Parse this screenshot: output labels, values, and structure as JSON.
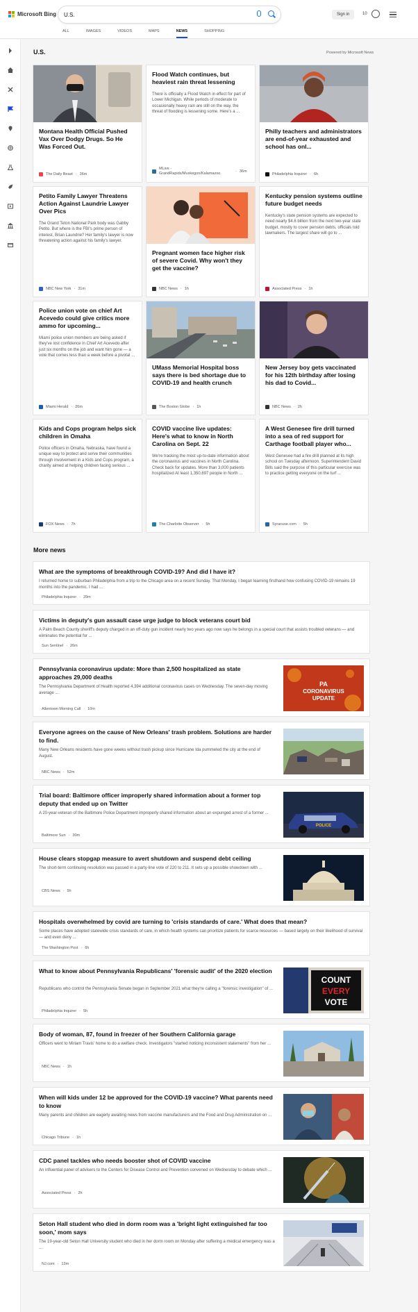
{
  "header": {
    "brand": "Microsoft Bing",
    "search_value": "U.S.",
    "signin_label": "Sign in",
    "rewards_count": "10",
    "tabs": [
      {
        "label": "ALL"
      },
      {
        "label": "IMAGES"
      },
      {
        "label": "VIDEOS"
      },
      {
        "label": "MAPS"
      },
      {
        "label": "NEWS",
        "active": true
      },
      {
        "label": "SHOPPING"
      }
    ]
  },
  "section": {
    "title": "U.S.",
    "powered_by": "Powered by Microsoft News"
  },
  "cards": [
    {
      "title": "Montana Health Official Pushed Vax Over Dodgy Drugs. So He Was Forced Out.",
      "source": "The Daily Beast",
      "time": "36m",
      "snippet": "",
      "icon": "man-in-mask-photo",
      "source_color": "#e8474f"
    },
    {
      "title": "Flood Watch continues, but heaviest rain threat lessening",
      "source": "MLive - GrandRapids/Muskegon/Kalamazoo",
      "time": "36m",
      "snippet": "There is officially a Flood Watch in effect for part of Lower Michigan. While periods of moderate to occasionally heavy rain are still on the way, the threat of flooding is lessening some. Here's a ...",
      "icon": "",
      "source_color": "#2b6e8f"
    },
    {
      "title": "Philly teachers and administrators are end-of-year exhausted and school has onl...",
      "source": "Philadelphia Inquirer",
      "time": "6h",
      "snippet": "",
      "icon": "woman-red-hair-photo",
      "source_color": "#111111"
    },
    {
      "title": "Petito Family Lawyer Threatens Action Against Laundrie Lawyer Over Pics",
      "source": "NBC New York",
      "time": "31m",
      "snippet": "The Grand Teton National Park body was Gabby Petito. But where is the FBI's prime person of interest, Brian Laundrie? Her family's lawyer is now threatening action against his family's lawyer.",
      "icon": "",
      "source_color": "#2f5fd0"
    },
    {
      "title": "Pregnant women face higher risk of severe Covid. Why won't they get the vaccine?",
      "source": "NBC News",
      "time": "1h",
      "snippet": "",
      "icon": "family-illustration-photo",
      "source_color": "#333333"
    },
    {
      "title": "Kentucky pension systems outline future budget needs",
      "source": "Associated Press",
      "time": "1h",
      "snippet": "Kentucky's state pension systems are expected to need nearly $4.6 billion from the next two-year state budget, mostly to cover pension debts, officials told lawmakers. The largest share will go to ...",
      "icon": "",
      "source_color": "#c8102e"
    },
    {
      "title": "Police union vote on chief Art Acevedo could give critics more ammo for upcoming...",
      "source": "Miami Herald",
      "time": "26m",
      "snippet": "Miami police union members are being asked if they've lost confidence in Chief Art Acevedo after just six months on the job and want him gone — a vote that comes less than a week before a pivotal ...",
      "icon": "",
      "source_color": "#1e5cb3"
    },
    {
      "title": "UMass Memorial Hospital boss says there is bed shortage due to COVID-19 and health crunch",
      "source": "The Boston Globe",
      "time": "1h",
      "snippet": "",
      "icon": "hospital-aerial-photo",
      "source_color": "#555555"
    },
    {
      "title": "New Jersey boy gets vaccinated for his 12th birthday after losing his dad to Covid...",
      "source": "NBC News",
      "time": "2h",
      "snippet": "",
      "icon": "boy-portrait-photo",
      "source_color": "#333333"
    },
    {
      "title": "Kids and Cops program helps sick children in Omaha",
      "source": "FOX News",
      "time": "7h",
      "snippet": "Police officers in Omaha, Nebraska, have found a unique way to protect and serve their communities through involvement in a Kids and Cops program, a charity aimed at helping children facing serious ...",
      "icon": "",
      "source_color": "#1a3a7a"
    },
    {
      "title": "COVID vaccine live updates: Here's what to know in North Carolina on Sept. 22",
      "source": "The Charlotte Observer",
      "time": "5h",
      "snippet": "We're tracking the most up-to-date information about the coronavirus and vaccines in North Carolina. Check back for updates. More than 3,000 patients hospitalized At least 1,350,697 people in North ...",
      "icon": "",
      "source_color": "#1f7fb0"
    },
    {
      "title": "A West Genesee fire drill turned into a sea of red support for Carthage football player who...",
      "source": "Syracuse.com",
      "time": "5h",
      "snippet": "West Genesee had a fire drill planned at its high school on Tuesday afternoon. Superintendent David Bills said the purpose of this particular exercise was to practice getting everyone on the turf ...",
      "icon": "",
      "source_color": "#2a64a8"
    }
  ],
  "more_news": {
    "title": "More news",
    "items": [
      {
        "title": "What are the symptoms of breakthrough COVID-19? And did I have it?",
        "snippet": "I returned home to suburban Philadelphia from a trip to the Chicago area on a recent Sunday. That Monday, I began learning firsthand how confusing COVID-19 remains 19 months into the pandemic. I had ...",
        "source": "Philadelphia Inquirer",
        "time": "29m",
        "image": "",
        "source_color": "#111111"
      },
      {
        "title": "Victims in deputy's gun assault case urge judge to block veterans court bid",
        "snippet": "A Palm Beach County sheriff's deputy charged in an off-duty gun incident nearly two years ago now says he belongs in a special court that assists troubled veterans — and eliminates the potential for ...",
        "source": "Sun Sentinel",
        "time": "26m",
        "image": "",
        "source_color": "#222222"
      },
      {
        "title": "Pennsylvania coronavirus update: More than 2,500 hospitalized as state approaches 29,000 deaths",
        "snippet": "The Pennsylvania Department of Health reported 4,394 additional coronavirus cases on Wednesday. The seven-day moving average ...",
        "source": "Allentown Morning Call",
        "time": "10m",
        "image": "pa-coronavirus-update-graphic",
        "image_text": "PA CORONAVIRUS UPDATE",
        "source_color": "#222222"
      },
      {
        "title": "Everyone agrees on the cause of New Orleans' trash problem. Solutions are harder to find.",
        "snippet": "Many New Orleans residents have gone weeks without trash pickup since Hurricane Ida pummeled the city at the end of August.",
        "source": "NBC News",
        "time": "52m",
        "image": "trash-pile-photo",
        "source_color": "#333333"
      },
      {
        "title": "Trial board: Baltimore officer improperly shared information about a former top deputy that ended up on Twitter",
        "snippet": "A 20-year-veteran of the Baltimore Police Department improperly shared information about an expunged arrest of a former ...",
        "source": "Baltimore Sun",
        "time": "30m",
        "image": "police-car-photo",
        "image_text": "POLICE",
        "source_color": "#e0a100"
      },
      {
        "title": "House clears stopgap measure to avert shutdown and suspend debt ceiling",
        "snippet": "The short-term continuing resolution was passed in a party-line vote of 220 to 211. It sets up a possible showdown with ...",
        "source": "CBS News",
        "time": "5h",
        "image": "capitol-dome-photo",
        "source_color": "#222222"
      },
      {
        "title": "Hospitals overwhelmed by covid are turning to 'crisis standards of care.' What does that mean?",
        "snippet": "Some places have adopted statewide crisis standards of care, in which health systems can prioritize patients for scarce resources — based largely on their likelihood of survival — and even deny ...",
        "source": "The Washington Post",
        "time": "6h",
        "image": "",
        "source_color": "#333333"
      },
      {
        "title": "What to know about Pennsylvania Republicans' 'forensic audit' of the 2020 election",
        "snippet": "Republicans who control the Pennsylvania Senate began in September 2021 what they're calling a \"forensic investigation\" of ...",
        "source": "Philadelphia Inquirer",
        "time": "5h",
        "image": "count-every-vote-photo",
        "image_text": "COUNT EVERY VOTE",
        "source_color": "#111111"
      },
      {
        "title": "Body of woman, 87, found in freezer of her Southern California garage",
        "snippet": "Officers went to Miriam Travis' home to do a welfare check. Investigators \"started noticing inconsistent statements\" from her ...",
        "source": "NBC News",
        "time": "1h",
        "image": "house-street-photo",
        "source_color": "#333333"
      },
      {
        "title": "When will kids under 12 be approved for the COVID-19 vaccine? What parents need to know",
        "snippet": "Many parents and children are eagerly awaiting news from vaccine manufacturers and the Food and Drug Administration on ...",
        "source": "Chicago Tribune",
        "time": "1h",
        "image": "child-vaccine-photo",
        "source_color": "#1e4fa0"
      },
      {
        "title": "CDC panel tackles who needs booster shot of COVID vaccine",
        "snippet": "An influential panel of advisers to the Centers for Disease Control and Prevention convened on Wednesday to debate which ...",
        "source": "Associated Press",
        "time": "2h",
        "image": "vaccine-syringe-photo",
        "source_color": "#c8102e"
      },
      {
        "title": "Seton Hall student who died in dorm room was a 'bright light extinguished far too soon,' mom says",
        "snippet": "The 19-year-old Seton Hall University student who died in her dorm room on Monday after suffering a medical emergency was a ...",
        "source": "NJ.com",
        "time": "13m",
        "image": "seton-hall-campus-photo",
        "source_color": "#444444"
      }
    ]
  },
  "icons": {
    "rail": [
      "chevron-right-icon",
      "home-icon",
      "tools-icon",
      "flag-icon",
      "location-icon",
      "globe-icon",
      "science-icon",
      "rocket-icon",
      "entertainment-icon",
      "bank-icon",
      "money-icon"
    ]
  },
  "colors": {
    "accent": "#174ae4",
    "brand_squares": [
      "#f25022",
      "#7fba00",
      "#00a4ef",
      "#ffb900"
    ]
  }
}
